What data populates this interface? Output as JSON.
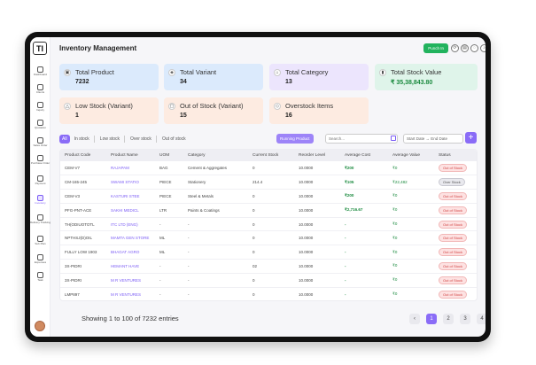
{
  "app": {
    "logo": "TI",
    "title": "Inventory Management"
  },
  "topbar": {
    "punch_label": "Punch In"
  },
  "sidebar": {
    "items": [
      {
        "label": "Dashboard"
      },
      {
        "label": "Clients"
      },
      {
        "label": "Inquiry"
      },
      {
        "label": "Quotation"
      },
      {
        "label": "Sales Order"
      },
      {
        "label": "Purchase Order"
      },
      {
        "label": "Payment"
      },
      {
        "label": "Inventory"
      },
      {
        "label": "Delivery Tracking"
      },
      {
        "label": "Sub Plan"
      },
      {
        "label": "Expenses"
      },
      {
        "label": "Task"
      }
    ]
  },
  "cards": [
    {
      "title": "Total Product",
      "value": "7232"
    },
    {
      "title": "Total Variant",
      "value": "34"
    },
    {
      "title": "Total Category",
      "value": "13"
    },
    {
      "title": "Total Stock Value",
      "value": "₹ 35,38,843.80"
    },
    {
      "title": "Low Stock (Variant)",
      "value": "1"
    },
    {
      "title": "Out of Stock (Variant)",
      "value": "15"
    },
    {
      "title": "Overstock Items",
      "value": "16"
    }
  ],
  "filters": {
    "all": "All",
    "in_stock": "In stock",
    "low_stock": "Low stock",
    "over_stock": "Over stock",
    "out_of_stock": "Out of stock"
  },
  "toolbar": {
    "running_product": "Running Product",
    "search_placeholder": "Search...",
    "date_range": "Start Date → End Date"
  },
  "table": {
    "headers": [
      "Product Code",
      "Product Name",
      "UOM",
      "Category",
      "Current Stock",
      "Reorder Level",
      "Average Cost",
      "Average Value",
      "Status"
    ],
    "rows": [
      [
        "CEM-V7",
        "RAJAPAM",
        "BAG",
        "Cement & Aggregates",
        "0",
        "10.0000",
        "₹200",
        "₹0",
        "Out of Stock"
      ],
      [
        "CM-165-245",
        "SWAMI STATIO",
        "PIECE",
        "Stationery",
        "214.4",
        "10.0000",
        "₹105",
        "₹22,482",
        "Over Stock"
      ],
      [
        "CEM-V3",
        "KASTURI STEE",
        "PIECE",
        "Steel & Metals",
        "0",
        "10.0000",
        "₹200",
        "₹0",
        "Out of Stock"
      ],
      [
        "PFG-PNT-ACE",
        "SAKHI MEDICL",
        "LTR",
        "Paints & Coatings",
        "0",
        "10.0000",
        "₹2,716.67",
        "₹0",
        "Out of Stock"
      ],
      [
        "TH(ODIUOTOTL",
        "ITC LTD (ENG)",
        "-",
        "-",
        "0",
        "10.0000",
        "-",
        "₹0",
        "Out of Stock"
      ],
      [
        "NPTHSJ(D)OIL",
        "MAMTA GEN STORE",
        "ML",
        "-",
        "0",
        "10.0000",
        "-",
        "₹0",
        "Out of Stock"
      ],
      [
        "FULLY LOW 1903",
        "BHAGAT AGRO",
        "ML",
        "-",
        "0",
        "10.0000",
        "-",
        "₹0",
        "Out of Stock"
      ],
      [
        "3X-PIDRI",
        "HEMANT HAVE",
        "-",
        "-",
        "02",
        "10.0000",
        "-",
        "₹0",
        "Out of Stock"
      ],
      [
        "3X-PIDRI",
        "M R VENTURES",
        "-",
        "-",
        "0",
        "10.0000",
        "-",
        "₹0",
        "Out of Stock"
      ],
      [
        "LMP897",
        "M R VENTURES",
        "-",
        "-",
        "0",
        "10.0000",
        "-",
        "₹0",
        "Out of Stock"
      ]
    ]
  },
  "footer": {
    "entries": "Showing 1 to 100 of 7232 entries",
    "pages": [
      "1",
      "2",
      "3",
      "4"
    ],
    "prev": "‹",
    "next": "›"
  }
}
